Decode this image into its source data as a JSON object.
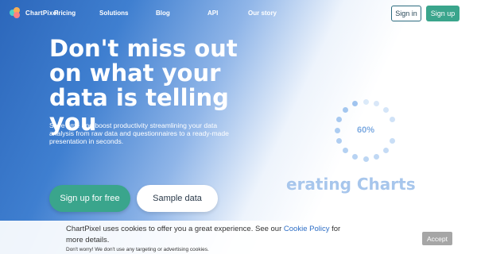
{
  "brand": {
    "name": "ChartPixel"
  },
  "nav": {
    "links": [
      "Pricing",
      "Solutions",
      "Blog",
      "API",
      "Our story"
    ],
    "sign_in": "Sign in",
    "sign_up": "Sign up"
  },
  "hero": {
    "headline": "Don't miss out on what your data is telling you",
    "subtext": "Save time and boost productivity streamlining your data analysis from raw data and questionnaires to a ready-made presentation in seconds.",
    "cta_primary": "Sign up for free",
    "cta_secondary": "Sample data"
  },
  "loader": {
    "percent": "60%",
    "progress": 0.6,
    "caption": "erating Charts"
  },
  "cookie_banner": {
    "text_before": "ChartPixel uses cookies to offer you a great experience. See our ",
    "link": "Cookie Policy",
    "text_after": " for more details.",
    "note": "Don't worry! We don't use any targeting or advertising cookies.",
    "accept": "Accept"
  },
  "colors": {
    "brand_green": "#3aa58c",
    "brand_blue": "#2c67bb",
    "loader_blue": "#9cc2ee"
  }
}
